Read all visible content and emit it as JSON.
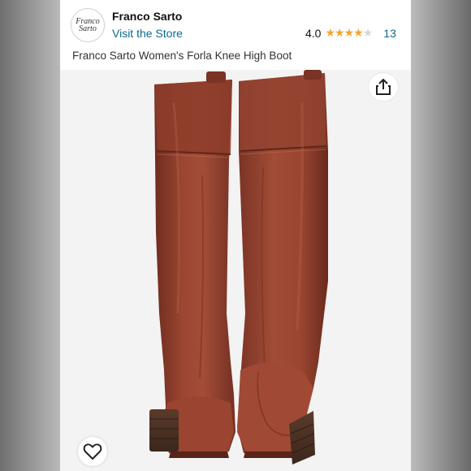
{
  "store": {
    "logo_line1": "Franco",
    "logo_line2": "Sarto",
    "name": "Franco Sarto",
    "visit_label": "Visit the Store"
  },
  "rating": {
    "value": "4.0",
    "stars_filled": 4,
    "stars_total": 5,
    "count": "13"
  },
  "product": {
    "title": "Franco Sarto Women's Forla Knee High Boot",
    "image": "pair-of-brown-leather-knee-high-boots"
  },
  "icons": {
    "share": "share-icon",
    "like": "heart-icon"
  },
  "colors": {
    "link": "#0b6a8e",
    "star": "#f3a530",
    "boot_leather": "#8f3e2b"
  }
}
